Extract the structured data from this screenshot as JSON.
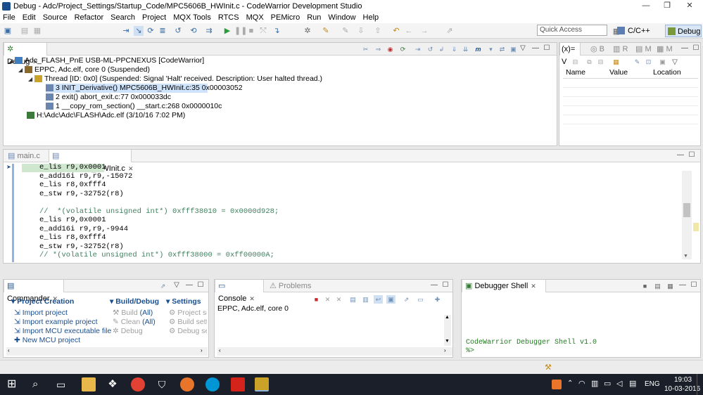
{
  "window": {
    "title": "Debug - Adc/Project_Settings/Startup_Code/MPC5606B_HWInit.c - CodeWarrior Development Studio",
    "minimize": "—",
    "restore": "❐",
    "close": "✕"
  },
  "menu": [
    "File",
    "Edit",
    "Source",
    "Refactor",
    "Search",
    "Project",
    "MQX Tools",
    "RTCS",
    "MQX",
    "PEMicro",
    "Run",
    "Window",
    "Help"
  ],
  "toolbar": {
    "quick_access_placeholder": "Quick Access",
    "perspective_cc": "C/C++",
    "perspective_debug": "Debug"
  },
  "debug_view": {
    "tab": "Debug",
    "tree": [
      "Adc_FLASH_PnE USB-ML-PPCNEXUS [CodeWarrior]",
      "EPPC, Adc.elf, core 0 (Suspended)",
      "Thread [ID: 0x0] (Suspended: Signal 'Halt' received. Description: User halted thread.)",
      "3 INIT_Derivative() MPC5606B_HWInit.c:35 0x00003052",
      "2 exit() abort_exit.c:77 0x000033dc",
      "1 __copy_rom_section() __start.c:268 0x0000010c",
      "H:\\Adc\\Adc\\FLASH\\Adc.elf (3/10/16 7:02 PM)"
    ]
  },
  "variables_view": {
    "tabs": [
      "(x)= V",
      "B",
      "R",
      "M",
      "M"
    ],
    "columns": [
      "Name",
      "Value",
      "Location"
    ]
  },
  "editor": {
    "tabs": [
      "main.c",
      "MPC5606B_HWInit.c"
    ],
    "lines": [
      "e_lis r9,0x0001",
      "e_add16i r9,r9,-15072",
      "e_lis r8,0xfff4",
      "e_stw r9,-32752(r8)",
      "",
      "//  *(volatile unsigned int*) 0xfff38010 = 0x0000d928;",
      "e_lis r9,0x0001",
      "e_add16i r9,r9,-9944",
      "e_lis r8,0xfff4",
      "e_stw r9,-32752(r8)",
      "// *(volatile unsigned int*) 0xfff38000 = 0xff00000A;"
    ]
  },
  "commander": {
    "tab": "Commander",
    "project_creation": {
      "header": "Project Creation",
      "items": [
        "Import project",
        "Import example project",
        "Import MCU executable file",
        "New MCU project"
      ]
    },
    "build_debug": {
      "header": "Build/Debug",
      "build": "Build",
      "build_all": "(All)",
      "clean": "Clean",
      "clean_all": "(All)",
      "debug": "Debug"
    },
    "settings": {
      "header": "Settings",
      "items": [
        "Project set",
        "Build setti",
        "Debug set"
      ]
    }
  },
  "console": {
    "tabs": [
      "Console",
      "Problems"
    ],
    "text": "EPPC, Adc.elf, core 0"
  },
  "shell": {
    "tab": "Debugger Shell",
    "line1": "CodeWarrior Debugger Shell v1.0",
    "line2": "%>"
  },
  "taskbar": {
    "lang": "ENG",
    "time": "19:03",
    "date": "10-03-2016"
  }
}
